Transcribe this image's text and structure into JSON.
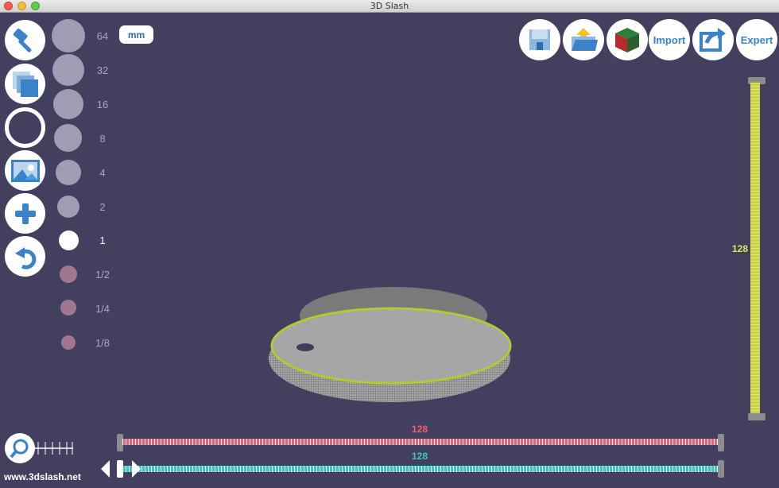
{
  "window": {
    "title": "3D Slash"
  },
  "unit": "mm",
  "sizes": [
    {
      "label": "64"
    },
    {
      "label": "32"
    },
    {
      "label": "16"
    },
    {
      "label": "8"
    },
    {
      "label": "4"
    },
    {
      "label": "2"
    },
    {
      "label": "1",
      "active": true
    },
    {
      "label": "1/2"
    },
    {
      "label": "1/4"
    },
    {
      "label": "1/8"
    }
  ],
  "toolbar": {
    "import_label": "Import",
    "expert_label": "Expert"
  },
  "sliders": {
    "vertical_value": "128",
    "horizontal_red_value": "128",
    "horizontal_teal_value": "128"
  },
  "footer": {
    "website": "www.3dslash.net"
  },
  "colors": {
    "background": "#42405e",
    "accent_blue": "#3b83c8",
    "slider_yellow": "#dfe36a",
    "slider_red": "#f05b74",
    "slider_teal": "#3cc6c2"
  },
  "icons": {
    "tools": [
      "hammer-icon",
      "cube-layers-icon",
      "circle-ring-icon",
      "image-icon",
      "plus-icon",
      "undo-icon"
    ],
    "top": [
      "save-icon",
      "open-folder-icon",
      "color-cube-icon",
      "share-icon"
    ]
  }
}
